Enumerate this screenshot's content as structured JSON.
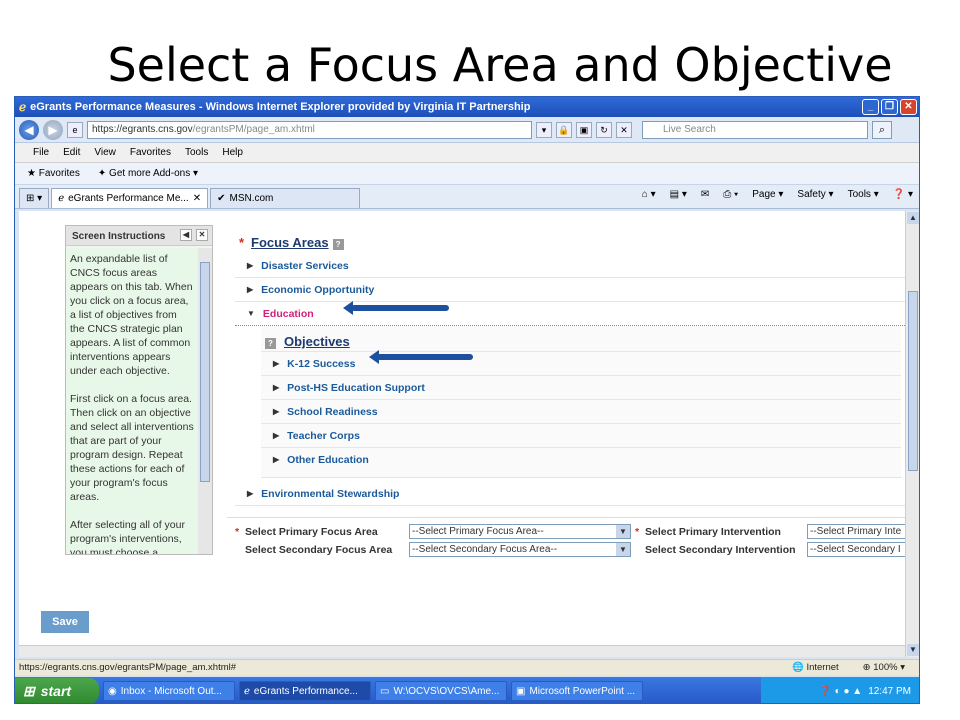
{
  "slide": {
    "title": "Select a Focus Area and Objective"
  },
  "window": {
    "title": "eGrants Performance Measures - Windows Internet Explorer provided by Virginia IT Partnership"
  },
  "address": {
    "url_prefix": "https://",
    "url_host": "egrants.cns.gov",
    "url_path": "/egrantsPM/page_am.xhtml",
    "search_placeholder": "Live Search"
  },
  "menu": [
    "File",
    "Edit",
    "View",
    "Favorites",
    "Tools",
    "Help"
  ],
  "favbar": {
    "favorites": "Favorites",
    "addons": "Get more Add-ons"
  },
  "tabs": [
    {
      "label": "eGrants Performance Me..."
    },
    {
      "label": "MSN.com"
    }
  ],
  "toolbar": {
    "page": "Page",
    "safety": "Safety",
    "tools": "Tools"
  },
  "instructions": {
    "title": "Screen Instructions",
    "paragraphs": [
      "An expandable list of CNCS focus areas appears on this tab. When you click on a focus area, a list of objectives from the CNCS strategic plan appears. A list of common interventions appears under each objective.",
      "First click on a focus area. Then click on an objective and select all interventions that are part of your program design. Repeat these actions for each of your program's focus areas.",
      "After selecting all of your program's interventions, you must choose a primary"
    ]
  },
  "focus": {
    "heading": "Focus Areas",
    "areas": [
      "Disaster Services",
      "Economic Opportunity",
      "Education",
      "Environmental Stewardship"
    ],
    "objectives_heading": "Objectives",
    "objectives": [
      "K-12 Success",
      "Post-HS Education Support",
      "School Readiness",
      "Teacher Corps",
      "Other Education"
    ]
  },
  "selects": {
    "primary_focus_label": "Select Primary Focus Area",
    "primary_focus_value": "--Select Primary Focus Area--",
    "secondary_focus_label": "Select Secondary Focus Area",
    "secondary_focus_value": "--Select Secondary Focus Area--",
    "primary_intervention_label": "Select Primary Intervention",
    "primary_intervention_value": "--Select Primary Inte",
    "secondary_intervention_label": "Select Secondary Intervention",
    "secondary_intervention_value": "--Select Secondary I"
  },
  "save_label": "Save",
  "status": {
    "url": "https://egrants.cns.gov/egrantsPM/page_am.xhtml#",
    "zone": "Internet",
    "zoom": "100%"
  },
  "taskbar": {
    "start": "start",
    "tasks": [
      "Inbox - Microsoft Out...",
      "eGrants Performance...",
      "W:\\OCVS\\OVCS\\Ame...",
      "Microsoft PowerPoint ..."
    ],
    "time": "12:47 PM"
  },
  "colors": {
    "link_blue": "#1a5a9a",
    "education_pink": "#d0207a",
    "arrow_blue": "#1f4f9f"
  }
}
